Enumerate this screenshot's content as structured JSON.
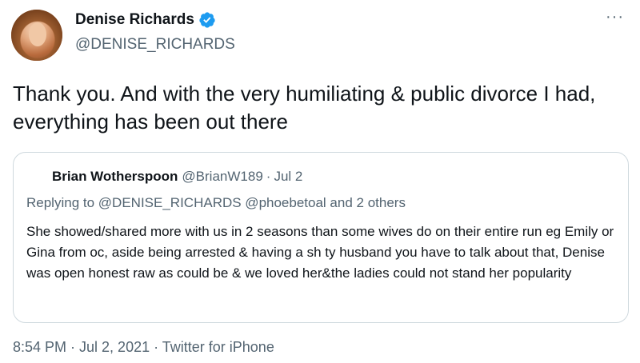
{
  "author": {
    "display_name": "Denise Richards",
    "handle": "@DENISE_RICHARDS",
    "verified": true
  },
  "tweet": {
    "text": "Thank you. And with the very humiliating & public divorce I had, everything has been out there"
  },
  "quoted_tweet": {
    "name": "Brian Wotherspoon",
    "handle": "@BrianW189",
    "separator": "·",
    "date": "Jul 2",
    "reply_prefix": "Replying to",
    "reply_mentions": "@DENISE_RICHARDS @phoebetoal and 2 others",
    "text": "She showed/shared more with us in 2 seasons than some wives do on their entire run eg Emily or Gina from oc, aside being arrested & having a sh  ty husband you have to talk about that, Denise was open honest raw as could be & we loved her&the ladies could not stand her popularity"
  },
  "meta": {
    "timestamp": "8:54 PM · Jul 2, 2021 · Twitter for iPhone"
  },
  "icons": {
    "more": "more-icon",
    "verified": "verified-badge-icon"
  },
  "colors": {
    "verified_blue": "#1d9bf0",
    "secondary_text": "#536471",
    "border": "#cfd9de"
  }
}
